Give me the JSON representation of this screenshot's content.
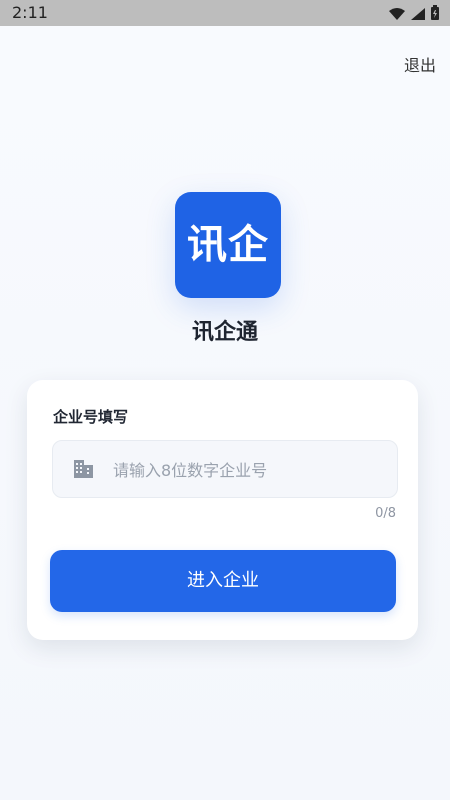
{
  "status_bar": {
    "time": "2:11",
    "icons": [
      "wifi-icon",
      "signal-icon",
      "battery-icon"
    ]
  },
  "header": {
    "logout_label": "退出"
  },
  "brand": {
    "logo_text": "讯企",
    "app_name": "讯企通"
  },
  "form": {
    "title": "企业号填写",
    "input": {
      "placeholder": "请输入8位数字企业号",
      "value": "",
      "counter": "0/8"
    },
    "submit_label": "进入企业"
  },
  "colors": {
    "primary": "#1f63e5",
    "page_bg": "#f7f9fd",
    "status_bg": "#bdbdbd"
  }
}
